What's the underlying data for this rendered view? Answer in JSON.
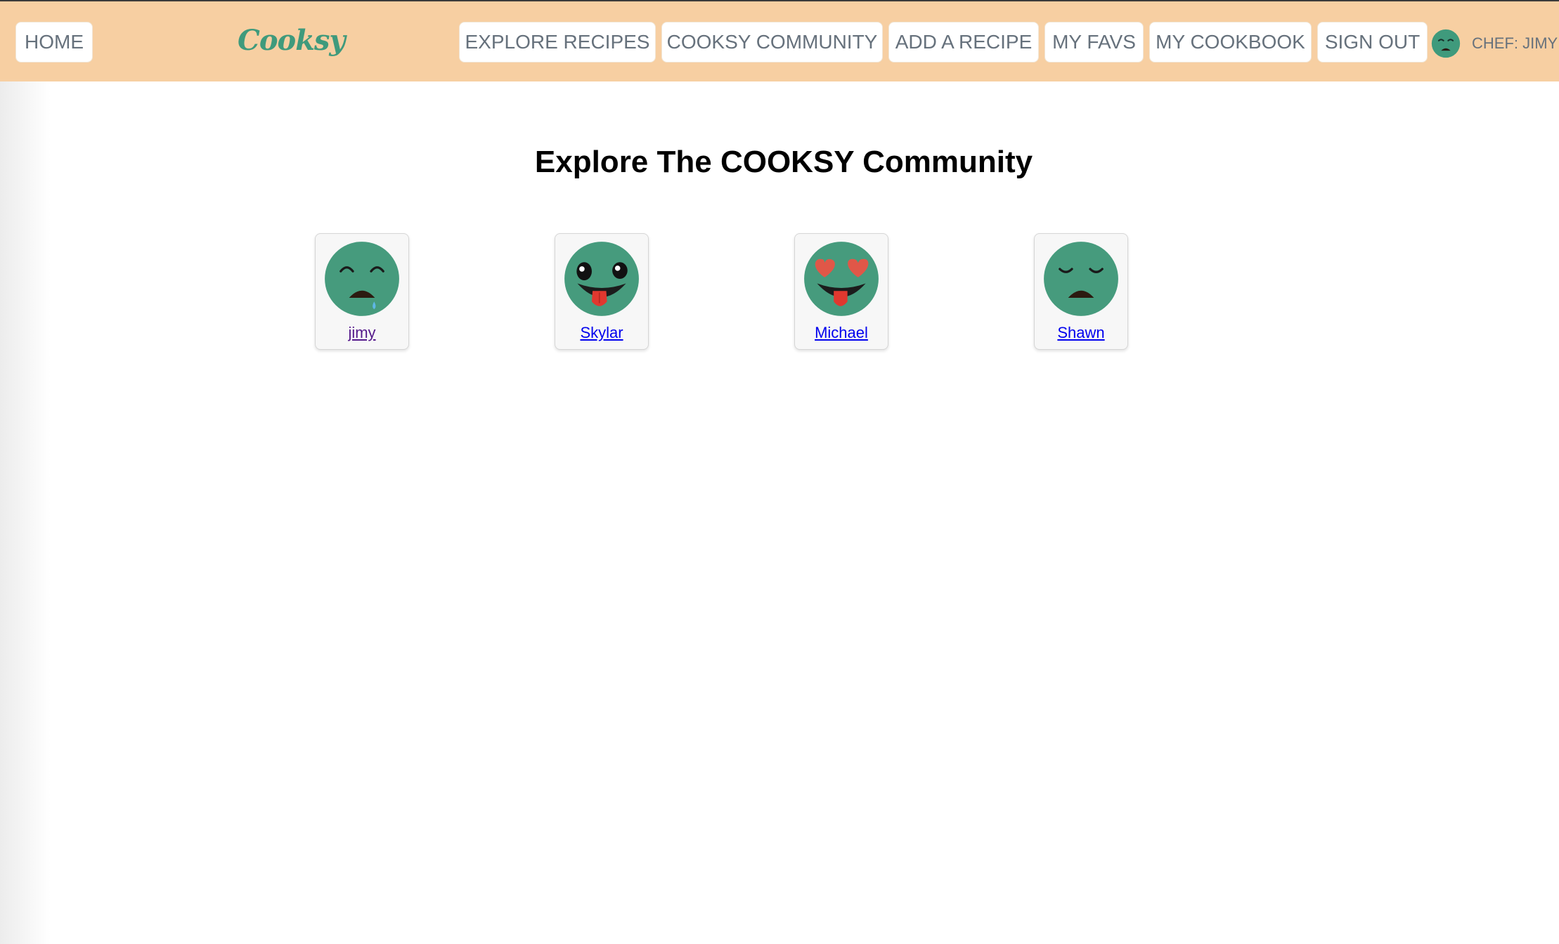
{
  "nav": {
    "home_label": "HOME",
    "logo_text": "Cooksy",
    "explore_label": "EXPLORE RECIPES",
    "community_label": "COOKSY COMMUNITY",
    "add_recipe_label": "ADD A RECIPE",
    "favs_label": "MY FAVS",
    "cookbook_label": "MY COOKBOOK",
    "signout_label": "SIGN OUT",
    "chef_label": "CHEF: JIMY",
    "chef_avatar_icon": "sad-face-icon"
  },
  "main": {
    "title": "Explore The COOKSY Community",
    "members": [
      {
        "name": "jimy",
        "avatar_icon": "crying-face-icon"
      },
      {
        "name": "Skylar",
        "avatar_icon": "tongue-out-face-icon"
      },
      {
        "name": "Michael",
        "avatar_icon": "heart-eyes-face-icon"
      },
      {
        "name": "Shawn",
        "avatar_icon": "sad-face-icon"
      }
    ]
  },
  "colors": {
    "header_bg": "#f7cfa2",
    "brand_green": "#3f9a7c",
    "nav_text": "#66717c",
    "link": "#0000ee",
    "visited_link": "#551a8b"
  }
}
